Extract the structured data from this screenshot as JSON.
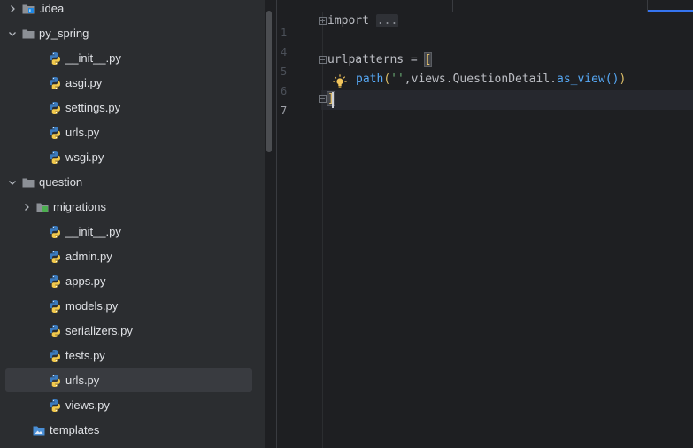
{
  "tree": {
    "items": [
      {
        "label": ".idea",
        "kind": "folder-idea",
        "chevron": "right"
      },
      {
        "label": "py_spring",
        "kind": "folder",
        "chevron": "down"
      },
      {
        "label": "__init__.py",
        "kind": "python"
      },
      {
        "label": "asgi.py",
        "kind": "python"
      },
      {
        "label": "settings.py",
        "kind": "python"
      },
      {
        "label": "urls.py",
        "kind": "python"
      },
      {
        "label": "wsgi.py",
        "kind": "python"
      },
      {
        "label": "question",
        "kind": "folder",
        "chevron": "down"
      },
      {
        "label": "migrations",
        "kind": "folder-green",
        "chevron": "right"
      },
      {
        "label": "__init__.py",
        "kind": "python"
      },
      {
        "label": "admin.py",
        "kind": "python"
      },
      {
        "label": "apps.py",
        "kind": "python"
      },
      {
        "label": "models.py",
        "kind": "python"
      },
      {
        "label": "serializers.py",
        "kind": "python"
      },
      {
        "label": "tests.py",
        "kind": "python"
      },
      {
        "label": "urls.py",
        "kind": "python",
        "selected": true
      },
      {
        "label": "views.py",
        "kind": "python"
      },
      {
        "label": "templates",
        "kind": "folder-templates"
      }
    ]
  },
  "editor": {
    "line_numbers": [
      "1",
      "4",
      "5",
      "6",
      "7"
    ],
    "current_line": "7",
    "lines": {
      "l1_import": "import",
      "l1_collapsed": "...",
      "l5_var": "urlpatterns",
      "l5_eq": " = ",
      "l5_bracket": "[",
      "l6_fn": "path",
      "l6_open": "(",
      "l6_str": "''",
      "l6_comma": ",",
      "l6_views": "views.QuestionDetail.",
      "l6_asview": "as_view",
      "l6_call": "()",
      "l6_close": ")",
      "l7_bracket": "]"
    }
  },
  "colors": {
    "accent": "#3574f0",
    "python_blue": "#3b7bbf",
    "python_yellow": "#f2c94c",
    "folder": "#8c9096",
    "bulb": "#f2c55c"
  }
}
